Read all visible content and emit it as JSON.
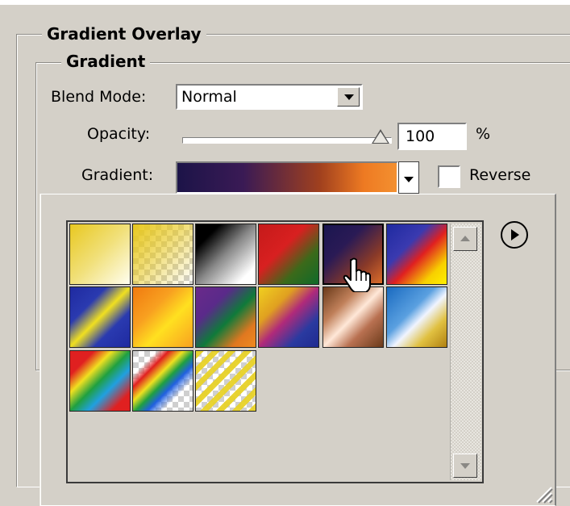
{
  "group": {
    "title": "Gradient Overlay"
  },
  "subgroup": {
    "title": "Gradient"
  },
  "blend_mode": {
    "label": "Blend Mode:",
    "value": "Normal"
  },
  "opacity": {
    "label": "Opacity:",
    "value": "100",
    "unit": "%",
    "level": 1.0
  },
  "gradient": {
    "label": "Gradient:",
    "selected": "Violet, Orange"
  },
  "reverse": {
    "label": "Reverse",
    "checked": false
  },
  "picker": {
    "menu_icon": "play-circle-icon",
    "selected_index": 4,
    "swatch_icons": [
      "gradient-swatch"
    ]
  },
  "colors": {
    "dialog_bg": "#d4d0c8",
    "selected_gradient_start": "#1c1448",
    "selected_gradient_end": "#f39030"
  }
}
